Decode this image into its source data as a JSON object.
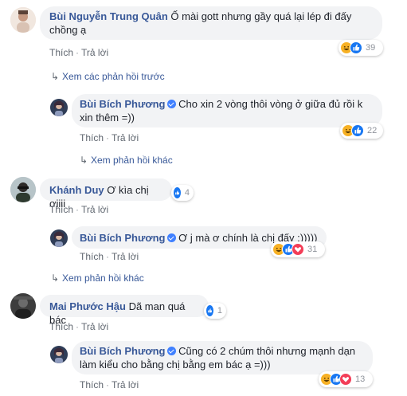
{
  "comments": [
    {
      "author": "Bùi Nguyễn Trung Quân",
      "text_line1": "Ố mài gott nhưng gầy quá lại lép đi đấy",
      "text_line2": "chồng ạ",
      "actions": {
        "like": "Thích",
        "reply": "Trả lời"
      },
      "reactions": {
        "icons": [
          "haha-icon",
          "like-icon"
        ],
        "count": "39"
      }
    },
    {
      "more_replies_prev": "Xem các phản hồi trước"
    },
    {
      "author": "Bùi Bích Phương",
      "text_line1": "Cho xin 2 vòng thôi vòng ở giữa đủ rồi k",
      "text_line2": "xin thêm =))",
      "actions": {
        "like": "Thích",
        "reply": "Trả lời"
      },
      "reactions": {
        "icons": [
          "haha-icon",
          "like-icon"
        ],
        "count": "22"
      },
      "more": "Xem phản hồi khác"
    },
    {
      "author": "Khánh Duy",
      "text": "Ơ kìa chị ơiiii",
      "actions": {
        "like": "Thích",
        "reply": "Trả lời"
      },
      "reactions": {
        "icons": [
          "like-icon"
        ],
        "count": "4"
      }
    },
    {
      "author": "Bùi Bích Phương",
      "text": "Ơ j mà ơ chính là chị đấy :)))))",
      "actions": {
        "like": "Thích",
        "reply": "Trả lời"
      },
      "reactions": {
        "icons": [
          "haha-icon",
          "like-icon",
          "love-icon"
        ],
        "count": "31"
      },
      "more": "Xem phản hồi khác"
    },
    {
      "author": "Mai Phước Hậu",
      "text": "Dã man quá bác",
      "actions": {
        "like": "Thích",
        "reply": "Trả lời"
      },
      "reactions": {
        "icons": [
          "like-icon"
        ],
        "count": "1"
      }
    },
    {
      "author": "Bùi Bích Phương",
      "text_line1": "Cũng có 2 chúm thôi nhưng mạnh dạn",
      "text_line2": "làm kiểu cho bằng chị bằng em bác ạ =)))",
      "actions": {
        "like": "Thích",
        "reply": "Trả lời"
      },
      "reactions": {
        "icons": [
          "haha-icon",
          "like-icon",
          "love-icon"
        ],
        "count": "13"
      }
    }
  ],
  "colors": {
    "name": "#385898",
    "bubble": "#f2f3f5",
    "action": "#606770",
    "like": "#1877f2",
    "haha": "#f7b125",
    "love": "#f33e58"
  }
}
